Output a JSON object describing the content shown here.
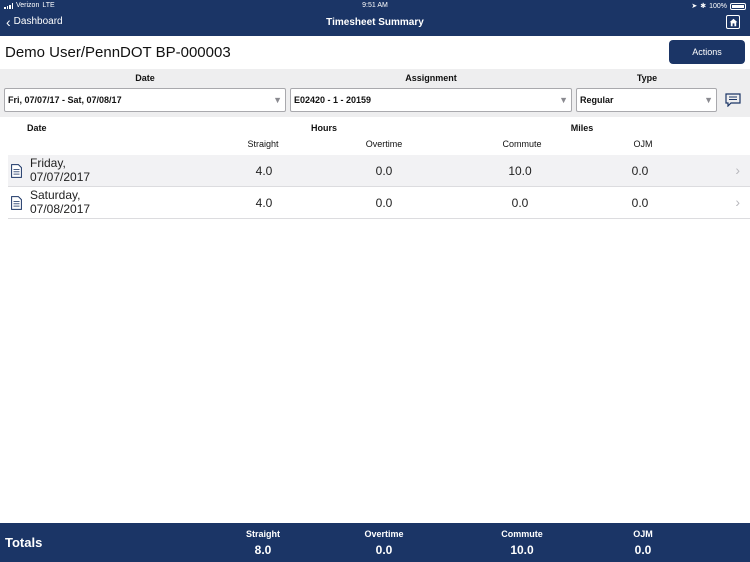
{
  "status": {
    "carrier": "Verizon",
    "network": "LTE",
    "time": "9:51 AM",
    "battery": "100%"
  },
  "nav": {
    "back_label": "Dashboard",
    "title": "Timesheet Summary"
  },
  "header": {
    "user_title": "Demo User/PennDOT BP-000003",
    "actions_label": "Actions"
  },
  "filters": {
    "date_label": "Date",
    "date_value": "Fri, 07/07/17 - Sat, 07/08/17",
    "assignment_label": "Assignment",
    "assignment_value": "E02420 - 1 - 20159",
    "type_label": "Type",
    "type_value": "Regular"
  },
  "table": {
    "date_header": "Date",
    "hours_header": "Hours",
    "miles_header": "Miles",
    "straight_header": "Straight",
    "overtime_header": "Overtime",
    "commute_header": "Commute",
    "ojm_header": "OJM",
    "rows": [
      {
        "day": "Friday,",
        "date": "07/07/2017",
        "straight": "4.0",
        "overtime": "0.0",
        "commute": "10.0",
        "ojm": "0.0"
      },
      {
        "day": "Saturday,",
        "date": "07/08/2017",
        "straight": "4.0",
        "overtime": "0.0",
        "commute": "0.0",
        "ojm": "0.0"
      }
    ]
  },
  "totals": {
    "label": "Totals",
    "straight_header": "Straight",
    "straight": "8.0",
    "overtime_header": "Overtime",
    "overtime": "0.0",
    "commute_header": "Commute",
    "commute": "10.0",
    "ojm_header": "OJM",
    "ojm": "0.0"
  },
  "colors": {
    "brand_navy": "#1b3566",
    "panel_gray": "#eeeeef",
    "row_alt": "#f2f2f4"
  },
  "icons": [
    "back-chevron-icon",
    "home-icon",
    "comment-icon",
    "document-icon",
    "row-chevron-icon",
    "dropdown-arrow-icon"
  ]
}
